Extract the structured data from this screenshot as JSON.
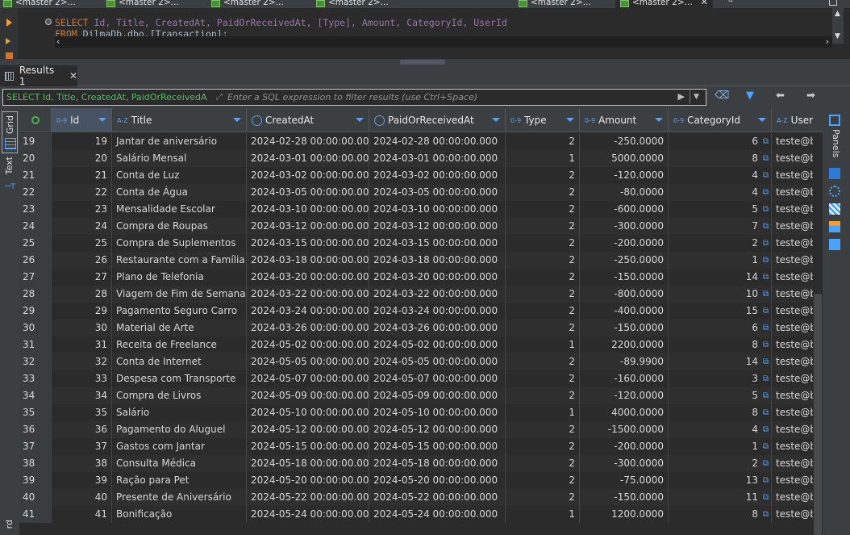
{
  "editor_tabs": [
    {
      "label": "<master 2>...",
      "active": false
    },
    {
      "label": "<master 2>...",
      "active": false
    },
    {
      "label": "<master 2>...",
      "active": false
    },
    {
      "label": "<master 2>...",
      "active": false
    },
    {
      "label": "<master 2>...",
      "active": false
    },
    {
      "label": "<master 2>...",
      "active": true
    }
  ],
  "tab_overflow_count": "4",
  "sql": {
    "line1": {
      "kw": "SELECT",
      "cols": "Id, Title, CreatedAt, PaidOrReceivedAt, [Type], Amount, CategoryId, UserId"
    },
    "line2": {
      "kw": "FROM",
      "table": "DilmaDb.dbo.[Transaction];"
    }
  },
  "results_tab": {
    "label": "Results 1"
  },
  "filter": {
    "query_prefix": "SELECT Id, Title, CreatedAt, PaidOrReceivedA",
    "placeholder": "Enter a SQL expression to filter results (use Ctrl+Space)"
  },
  "side": {
    "grid_label": "Grid",
    "text_label": "Text",
    "panels_label": "Panels",
    "bottom_label": "rd"
  },
  "columns": [
    {
      "name": "Id",
      "type": "0-9"
    },
    {
      "name": "Title",
      "type": "A-Z"
    },
    {
      "name": "CreatedAt",
      "type": "clock"
    },
    {
      "name": "PaidOrReceivedAt",
      "type": "clock"
    },
    {
      "name": "Type",
      "type": "0-9"
    },
    {
      "name": "Amount",
      "type": "0-9"
    },
    {
      "name": "CategoryId",
      "type": "0-9"
    },
    {
      "name": "User",
      "type": "A-Z"
    }
  ],
  "rows": [
    {
      "rn": "19",
      "id": "19",
      "title": "Jantar de aniversário",
      "created": "2024-02-28 00:00:00.000",
      "paid": "2024-02-28 00:00:00.000",
      "type": "2",
      "amount": "-250.0000",
      "cat": "6",
      "user": "teste@b"
    },
    {
      "rn": "20",
      "id": "20",
      "title": "Salário Mensal",
      "created": "2024-03-01 00:00:00.000",
      "paid": "2024-03-01 00:00:00.000",
      "type": "1",
      "amount": "5000.0000",
      "cat": "8",
      "user": "teste@b"
    },
    {
      "rn": "21",
      "id": "21",
      "title": "Conta de Luz",
      "created": "2024-03-02 00:00:00.000",
      "paid": "2024-03-02 00:00:00.000",
      "type": "2",
      "amount": "-120.0000",
      "cat": "4",
      "user": "teste@b"
    },
    {
      "rn": "22",
      "id": "22",
      "title": "Conta de Água",
      "created": "2024-03-05 00:00:00.000",
      "paid": "2024-03-05 00:00:00.000",
      "type": "2",
      "amount": "-80.0000",
      "cat": "4",
      "user": "teste@b"
    },
    {
      "rn": "23",
      "id": "23",
      "title": "Mensalidade Escolar",
      "created": "2024-03-10 00:00:00.000",
      "paid": "2024-03-10 00:00:00.000",
      "type": "2",
      "amount": "-600.0000",
      "cat": "5",
      "user": "teste@b"
    },
    {
      "rn": "24",
      "id": "24",
      "title": "Compra de Roupas",
      "created": "2024-03-12 00:00:00.000",
      "paid": "2024-03-12 00:00:00.000",
      "type": "2",
      "amount": "-300.0000",
      "cat": "7",
      "user": "teste@b"
    },
    {
      "rn": "25",
      "id": "25",
      "title": "Compra de Suplementos",
      "created": "2024-03-15 00:00:00.000",
      "paid": "2024-03-15 00:00:00.000",
      "type": "2",
      "amount": "-200.0000",
      "cat": "2",
      "user": "teste@b"
    },
    {
      "rn": "26",
      "id": "26",
      "title": "Restaurante com a Família",
      "created": "2024-03-18 00:00:00.000",
      "paid": "2024-03-18 00:00:00.000",
      "type": "2",
      "amount": "-250.0000",
      "cat": "1",
      "user": "teste@b"
    },
    {
      "rn": "27",
      "id": "27",
      "title": "Plano de Telefonia",
      "created": "2024-03-20 00:00:00.000",
      "paid": "2024-03-20 00:00:00.000",
      "type": "2",
      "amount": "-150.0000",
      "cat": "14",
      "user": "teste@b"
    },
    {
      "rn": "28",
      "id": "28",
      "title": "Viagem de Fim de Semana",
      "created": "2024-03-22 00:00:00.000",
      "paid": "2024-03-22 00:00:00.000",
      "type": "2",
      "amount": "-800.0000",
      "cat": "10",
      "user": "teste@b"
    },
    {
      "rn": "29",
      "id": "29",
      "title": "Pagamento Seguro Carro",
      "created": "2024-03-24 00:00:00.000",
      "paid": "2024-03-24 00:00:00.000",
      "type": "2",
      "amount": "-400.0000",
      "cat": "15",
      "user": "teste@b"
    },
    {
      "rn": "30",
      "id": "30",
      "title": "Material de Arte",
      "created": "2024-03-26 00:00:00.000",
      "paid": "2024-03-26 00:00:00.000",
      "type": "2",
      "amount": "-150.0000",
      "cat": "6",
      "user": "teste@b"
    },
    {
      "rn": "31",
      "id": "31",
      "title": "Receita de Freelance",
      "created": "2024-05-02 00:00:00.000",
      "paid": "2024-05-02 00:00:00.000",
      "type": "1",
      "amount": "2200.0000",
      "cat": "8",
      "user": "teste@b"
    },
    {
      "rn": "32",
      "id": "32",
      "title": "Conta de Internet",
      "created": "2024-05-05 00:00:00.000",
      "paid": "2024-05-05 00:00:00.000",
      "type": "2",
      "amount": "-89.9900",
      "cat": "14",
      "user": "teste@b"
    },
    {
      "rn": "33",
      "id": "33",
      "title": "Despesa com Transporte",
      "created": "2024-05-07 00:00:00.000",
      "paid": "2024-05-07 00:00:00.000",
      "type": "2",
      "amount": "-160.0000",
      "cat": "3",
      "user": "teste@b"
    },
    {
      "rn": "34",
      "id": "34",
      "title": "Compra de Livros",
      "created": "2024-05-09 00:00:00.000",
      "paid": "2024-05-09 00:00:00.000",
      "type": "2",
      "amount": "-120.0000",
      "cat": "5",
      "user": "teste@b"
    },
    {
      "rn": "35",
      "id": "35",
      "title": "Salário",
      "created": "2024-05-10 00:00:00.000",
      "paid": "2024-05-10 00:00:00.000",
      "type": "1",
      "amount": "4000.0000",
      "cat": "8",
      "user": "teste@b"
    },
    {
      "rn": "36",
      "id": "36",
      "title": "Pagamento do Aluguel",
      "created": "2024-05-12 00:00:00.000",
      "paid": "2024-05-12 00:00:00.000",
      "type": "2",
      "amount": "-1500.0000",
      "cat": "4",
      "user": "teste@b"
    },
    {
      "rn": "37",
      "id": "37",
      "title": "Gastos com Jantar",
      "created": "2024-05-15 00:00:00.000",
      "paid": "2024-05-15 00:00:00.000",
      "type": "2",
      "amount": "-200.0000",
      "cat": "1",
      "user": "teste@b"
    },
    {
      "rn": "38",
      "id": "38",
      "title": "Consulta Médica",
      "created": "2024-05-18 00:00:00.000",
      "paid": "2024-05-18 00:00:00.000",
      "type": "2",
      "amount": "-300.0000",
      "cat": "2",
      "user": "teste@b"
    },
    {
      "rn": "39",
      "id": "39",
      "title": "Ração para Pet",
      "created": "2024-05-20 00:00:00.000",
      "paid": "2024-05-20 00:00:00.000",
      "type": "2",
      "amount": "-75.0000",
      "cat": "13",
      "user": "teste@b"
    },
    {
      "rn": "40",
      "id": "40",
      "title": "Presente de Aniversário",
      "created": "2024-05-22 00:00:00.000",
      "paid": "2024-05-22 00:00:00.000",
      "type": "2",
      "amount": "-150.0000",
      "cat": "11",
      "user": "teste@b"
    },
    {
      "rn": "41",
      "id": "41",
      "title": "Bonificação",
      "created": "2024-05-24 00:00:00.000",
      "paid": "2024-05-24 00:00:00.000",
      "type": "1",
      "amount": "1200.0000",
      "cat": "8",
      "user": "teste@b"
    }
  ],
  "colors": {
    "keyword": "#cc7832",
    "column": "#9876aa",
    "accent": "#5ea0e8",
    "filter_text": "#5fb36b"
  }
}
